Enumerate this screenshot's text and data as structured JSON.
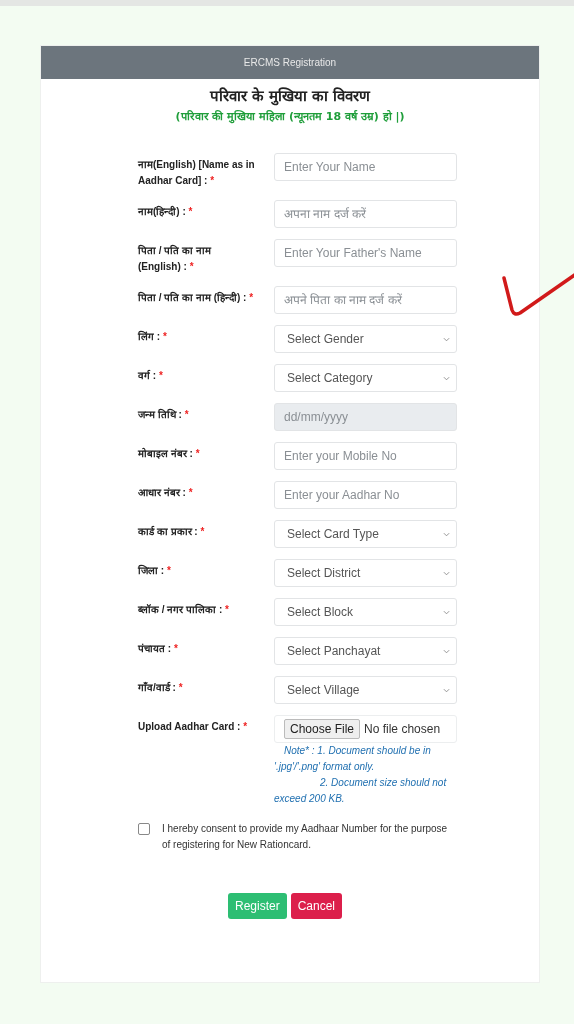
{
  "header": {
    "title": "ERCMS Registration"
  },
  "heading": "परिवार के मुखिया का विवरण",
  "subheading": "(परिवार की मुखिया महिला (न्यूनतम 18 वर्ष उम्र) हो |)",
  "fields": [
    {
      "label": "नाम(English) [Name as in Aadhar Card] :",
      "mark": "*",
      "kind": "input",
      "placeholder": "Enter Your Name",
      "disabled": false
    },
    {
      "label": "नाम(हिन्दी) :",
      "mark": "*",
      "kind": "input",
      "placeholder": "अपना नाम दर्ज करें",
      "disabled": false
    },
    {
      "label": "पिता / पति का नाम (English) :",
      "mark": "*",
      "kind": "input",
      "placeholder": "Enter Your Father's Name",
      "disabled": false
    },
    {
      "label": "पिता / पति का नाम (हिन्दी) :",
      "mark": "*",
      "kind": "input",
      "placeholder": "अपने पिता का नाम दर्ज करें",
      "disabled": false
    },
    {
      "label": "लिंग :",
      "mark": "*",
      "kind": "select",
      "value": "Select Gender",
      "disabled": false
    },
    {
      "label": "वर्ग :",
      "mark": "*",
      "kind": "select",
      "value": "Select Category",
      "disabled": false
    },
    {
      "label": "जन्म तिथि :",
      "mark": "*",
      "kind": "input",
      "placeholder": "dd/mm/yyyy",
      "disabled": true
    },
    {
      "label": "मोबाइल नंबर :",
      "mark": "*",
      "kind": "input",
      "placeholder": "Enter your Mobile No",
      "disabled": false
    },
    {
      "label": "आधार नंबर :",
      "mark": "*",
      "kind": "input",
      "placeholder": "Enter your Aadhar No",
      "disabled": false
    },
    {
      "label": "कार्ड का प्रकार :",
      "mark": "*",
      "kind": "select",
      "value": "Select Card Type",
      "disabled": false
    },
    {
      "label": "जिला :",
      "mark": "*",
      "kind": "select",
      "value": "Select District",
      "disabled": false
    },
    {
      "label": "ब्लॉक / नगर पालिका :",
      "mark": "*",
      "kind": "select",
      "value": "Select Block",
      "disabled": false
    },
    {
      "label": "पंचायत :",
      "mark": "*",
      "kind": "select",
      "value": "Select Panchayat",
      "disabled": false
    },
    {
      "label": "गाँव/वार्ड :",
      "mark": "*",
      "kind": "select",
      "value": "Select Village",
      "disabled": false
    },
    {
      "label": "Upload Aadhar Card :",
      "mark": "*",
      "kind": "file",
      "button": "Choose File",
      "status": "No file chosen",
      "notes": [
        "Note* : 1. Document should be in '.jpg'/'.png' format only.",
        "2. Document size should not exceed 200 KB."
      ]
    }
  ],
  "consent": {
    "checked": false,
    "text": "I hereby consent to provide my Aadhaar Number for the purpose of registering for New Rationcard."
  },
  "buttons": [
    {
      "kind": "primary",
      "label": "Register"
    },
    {
      "kind": "danger",
      "label": "Cancel"
    }
  ]
}
